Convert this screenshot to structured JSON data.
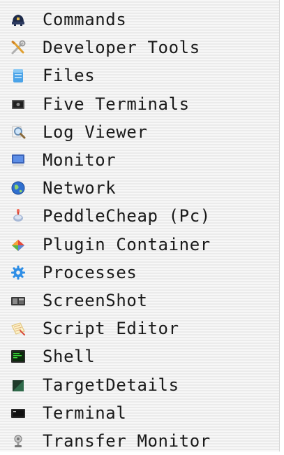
{
  "menu": {
    "items": [
      {
        "label": "Commands",
        "icon": "commands-icon"
      },
      {
        "label": "Developer Tools",
        "icon": "developer-tools-icon"
      },
      {
        "label": "Files",
        "icon": "files-icon"
      },
      {
        "label": "Five Terminals",
        "icon": "five-terminals-icon"
      },
      {
        "label": "Log Viewer",
        "icon": "log-viewer-icon"
      },
      {
        "label": "Monitor",
        "icon": "monitor-icon"
      },
      {
        "label": "Network",
        "icon": "network-icon"
      },
      {
        "label": "PeddleCheap (Pc)",
        "icon": "peddlecheap-icon"
      },
      {
        "label": "Plugin Container",
        "icon": "plugin-container-icon"
      },
      {
        "label": "Processes",
        "icon": "processes-icon"
      },
      {
        "label": "ScreenShot",
        "icon": "screenshot-icon"
      },
      {
        "label": "Script Editor",
        "icon": "script-editor-icon"
      },
      {
        "label": "Shell",
        "icon": "shell-icon"
      },
      {
        "label": "TargetDetails",
        "icon": "target-details-icon"
      },
      {
        "label": "Terminal",
        "icon": "terminal-icon"
      },
      {
        "label": "Transfer Monitor",
        "icon": "transfer-monitor-icon"
      }
    ]
  },
  "colors": {
    "text": "#1a1a1a",
    "stripe_light": "#f7f7f7",
    "stripe_dark": "#ebebeb"
  }
}
